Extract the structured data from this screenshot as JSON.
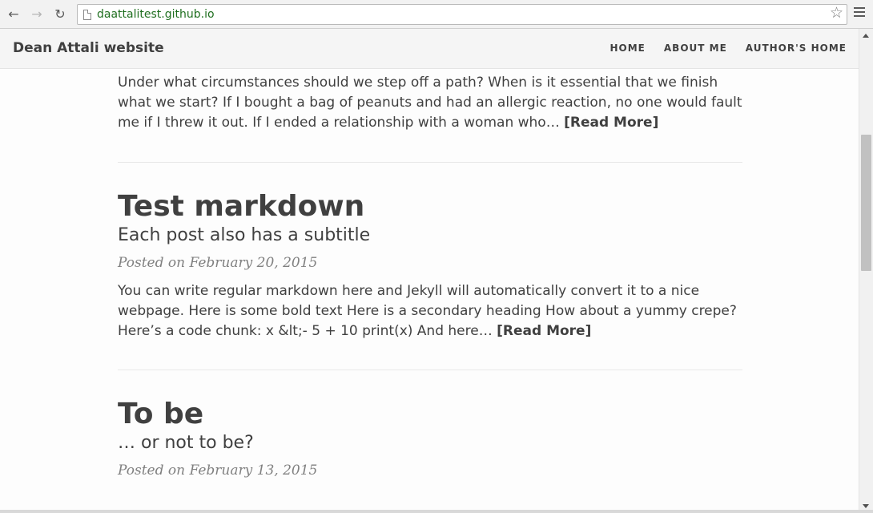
{
  "browser": {
    "url": "daattalitest.github.io",
    "back_icon": "arrow-left-icon",
    "forward_icon": "arrow-right-icon",
    "reload_icon": "reload-icon",
    "bookmark_icon": "star-icon",
    "menu_icon": "hamburger-menu-icon"
  },
  "navbar": {
    "brand": "Dean Attali website",
    "links": [
      "HOME",
      "ABOUT ME",
      "AUTHOR'S HOME"
    ]
  },
  "posts": [
    {
      "preview": "Under what circumstances should we step off a path? When is it essential that we finish what we start? If I bought a bag of peanuts and had an allergic reaction, no one would fault me if I threw it out. If I ended a relationship with a woman who…",
      "read_more": "[Read More]"
    },
    {
      "title": "Test markdown",
      "subtitle": "Each post also has a subtitle",
      "meta": "Posted on February 20, 2015",
      "preview": "You can write regular markdown here and Jekyll will automatically convert it to a nice webpage. Here is some bold text Here is a secondary heading How about a yummy crepe? Here’s a code chunk: x &lt;- 5 + 10 print(x) And here…",
      "read_more": "[Read More]"
    },
    {
      "title": "To be",
      "subtitle": "… or not to be?",
      "meta": "Posted on February 13, 2015"
    }
  ]
}
